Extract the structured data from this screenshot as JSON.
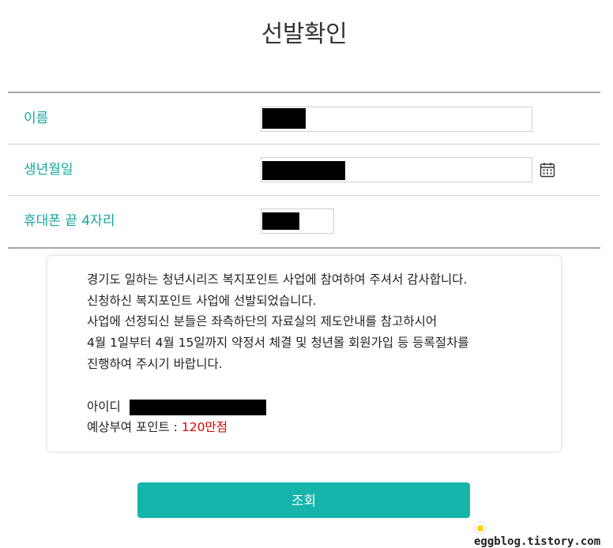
{
  "page": {
    "title": "선발확인"
  },
  "form": {
    "name_label": "이름",
    "birth_label": "생년월일",
    "phone_label": "휴대폰 끝 4자리"
  },
  "notice": {
    "line1": "경기도 일하는 청년시리즈 복지포인트 사업에 참여하여 주셔서 감사합니다.",
    "line2": "신청하신 복지포인트 사업에 선발되었습니다.",
    "line3": "사업에 선정되신 분들은 좌측하단의 자료실의 제도안내를 참고하시어",
    "line4": "4월 1일부터 4월 15일까지 약정서 체결 및 청년몰 회원가입 등 등록절차를",
    "line5": "진행하여 주시기 바랍니다.",
    "id_label": "아이디",
    "points_label": "예상부여 포인트 :",
    "points_value": "120만점"
  },
  "buttons": {
    "submit_label": "조회"
  },
  "watermark": {
    "text": "eggblog.tistory.com"
  },
  "colors": {
    "accent": "#16b4aa",
    "label": "#16a5a0",
    "points": "#e00000"
  },
  "icons": {
    "date_picker": "calendar-icon"
  }
}
